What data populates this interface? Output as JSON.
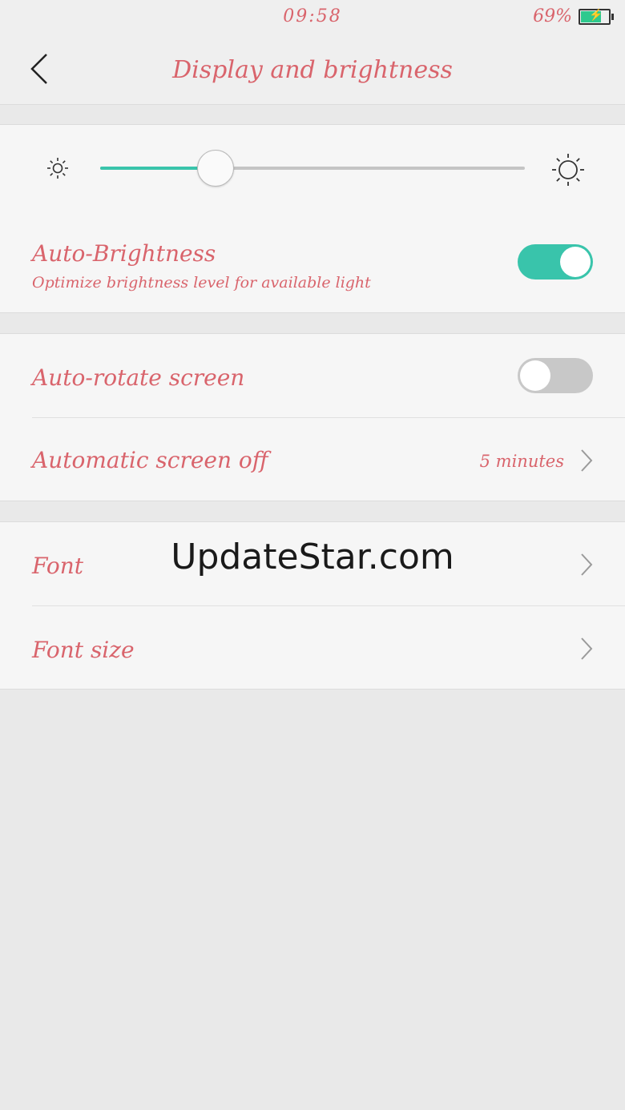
{
  "status_bar": {
    "time": "09:58",
    "battery_percent": "69%",
    "battery_level": 0.69
  },
  "header": {
    "title": "Display and brightness"
  },
  "brightness": {
    "level": 0.27
  },
  "auto_brightness": {
    "label": "Auto-Brightness",
    "description": "Optimize brightness level for available light",
    "enabled": true
  },
  "auto_rotate": {
    "label": "Auto-rotate screen",
    "enabled": false
  },
  "screen_off": {
    "label": "Automatic screen off",
    "value": "5 minutes"
  },
  "font": {
    "label": "Font"
  },
  "font_size": {
    "label": "Font size"
  },
  "watermark": "UpdateStar.com",
  "colors": {
    "accent": "#39c4ab",
    "text": "#d9646c",
    "background": "#e9e9e9"
  }
}
